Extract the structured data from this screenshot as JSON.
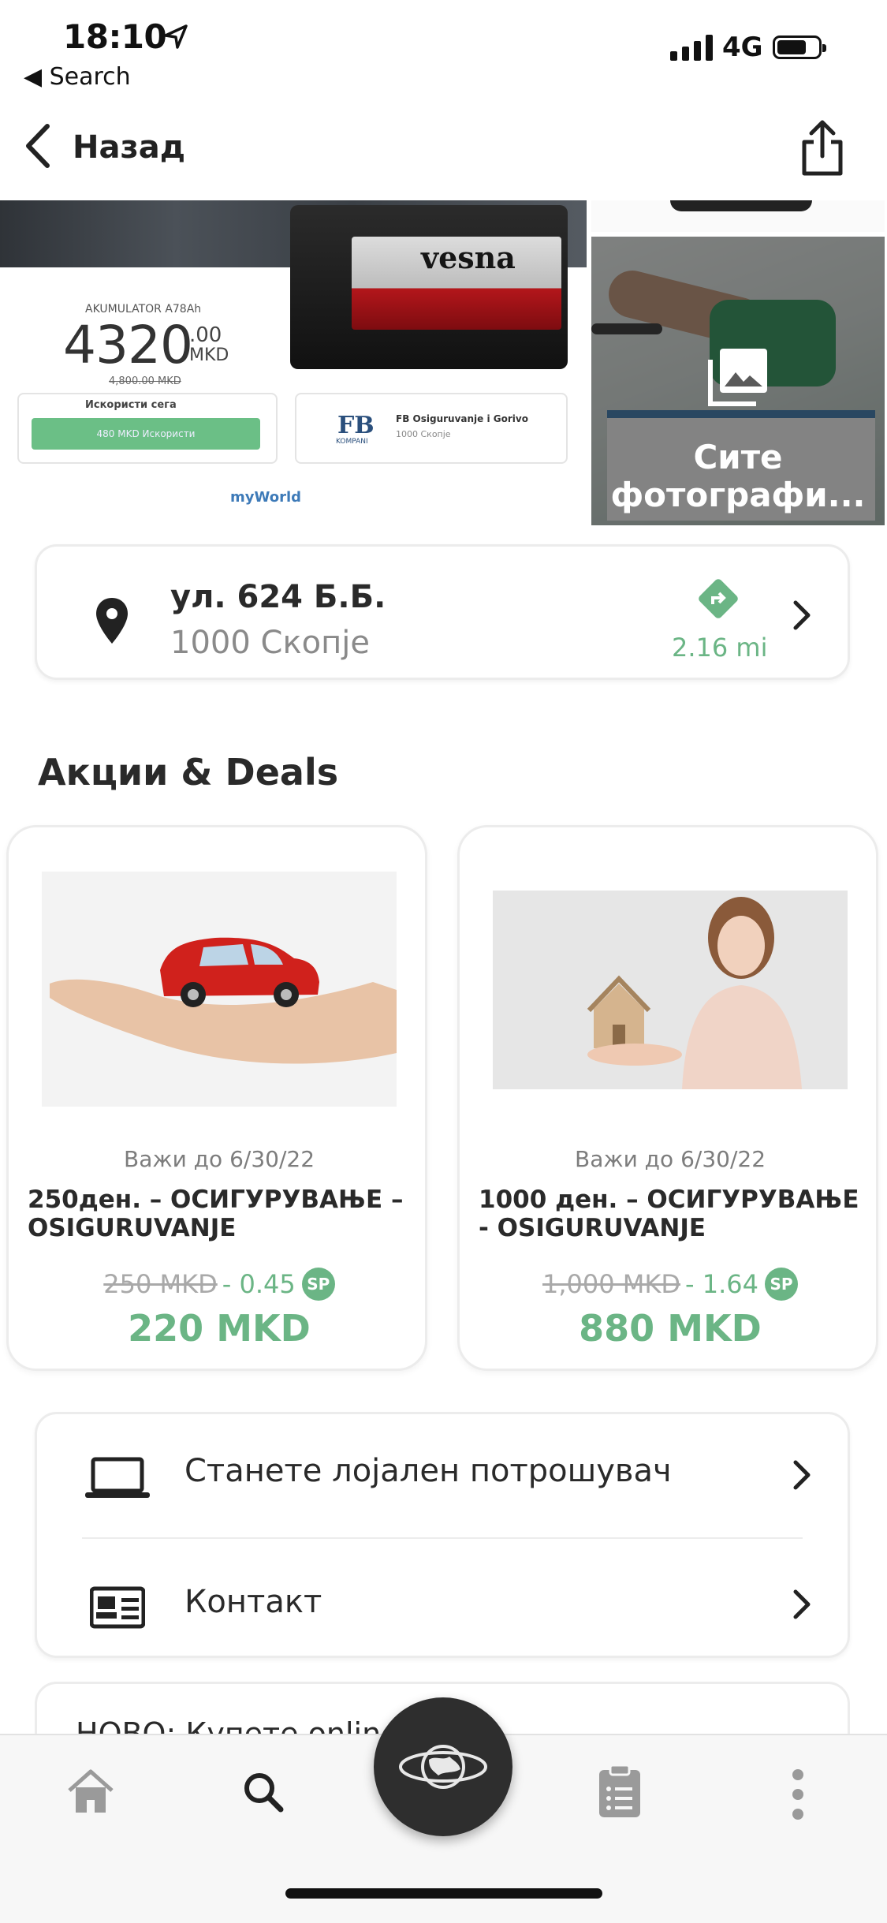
{
  "status_bar": {
    "time": "18:10",
    "back_app": "◀ Search",
    "network": "4G",
    "icons": [
      "location-arrow-icon",
      "signal-icon",
      "battery-icon"
    ]
  },
  "nav": {
    "back_label": "Назад",
    "share_icon": "share-icon"
  },
  "photos": {
    "banner": {
      "brand": "vesna",
      "product_name": "AKUMULATOR A78Ah",
      "price_whole": "4320",
      "price_cents": ".00",
      "currency": "MKD",
      "old_price": "4,800.00 MKD",
      "cta_title": "Искористи сега",
      "cta_button": "480 MKD  Искористи",
      "partner_logo": "FB",
      "partner_logo_sub": "KOMPANI",
      "partner_name": "FB Osiguruvanje i Gorivo",
      "partner_location": "1000 Скопје",
      "footer_logo": "myWorld"
    },
    "all_photos_label": "Сите фотографи..."
  },
  "address": {
    "street": "ул. 624 Б.Б.",
    "city": "1000 Скопје",
    "distance": "2.16 mi"
  },
  "deals_section": {
    "title": "Акции & Deals",
    "deals": [
      {
        "valid_until": "Важи до 6/30/22",
        "title": "250ден. – ОСИГУРУВАЊЕ – OSIGURUVANJE",
        "old_price": "250 MKD",
        "points": "- 0.45",
        "badge": "SP",
        "price": "220 MKD"
      },
      {
        "valid_until": "Важи до 6/30/22",
        "title": "1000 ден. – ОСИГУРУВАЊЕ - OSIGURUVANJE",
        "old_price": "1,000 MKD",
        "points": "- 1.64",
        "badge": "SP",
        "price": "880 MKD"
      }
    ]
  },
  "menu": {
    "items": [
      {
        "label": "Станете лојален потрошувач",
        "icon": "laptop-icon"
      },
      {
        "label": "Контакт",
        "icon": "contact-card-icon"
      }
    ]
  },
  "partial_item": {
    "text": "НОВО: Купете online ... за"
  },
  "tab_bar": {
    "tabs": [
      "home-icon",
      "search-icon",
      "myworld-globe-icon",
      "shopping-list-icon",
      "more-icon"
    ]
  },
  "colors": {
    "accent_green": "#6bb585",
    "text_dark": "#2a2a2a",
    "text_muted": "#8a8a8a",
    "fab_dark": "#2e2e2e"
  }
}
